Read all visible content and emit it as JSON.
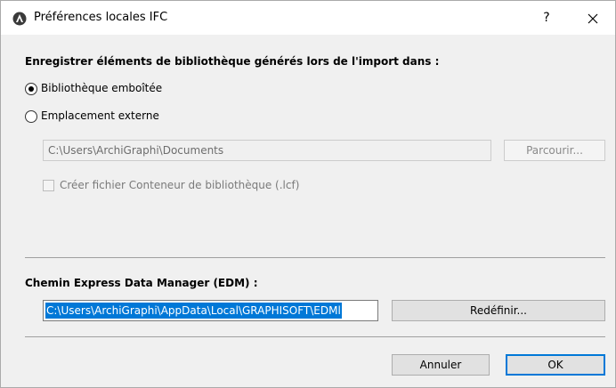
{
  "window": {
    "title": "Préférences locales IFC",
    "help_label": "?",
    "icon": "archicad-app-icon"
  },
  "library_section": {
    "heading": "Enregistrer éléments de bibliothèque générés lors de l'import dans :",
    "options": [
      {
        "label": "Bibliothèque emboîtée",
        "selected": true
      },
      {
        "label": "Emplacement externe",
        "selected": false
      }
    ],
    "external_path": "C:\\Users\\ArchiGraphi\\Documents",
    "browse_label": "Parcourir...",
    "container_checkbox": {
      "label": "Créer fichier Conteneur de bibliothèque (.lcf)",
      "checked": false,
      "enabled": false
    }
  },
  "edm_section": {
    "heading": "Chemin Express Data Manager (EDM) :",
    "path_value": "C:\\Users\\ArchiGraphi\\AppData\\Local\\GRAPHISOFT\\EDMl",
    "redefine_label": "Redéfinir..."
  },
  "footer": {
    "cancel_label": "Annuler",
    "ok_label": "OK"
  },
  "colors": {
    "accent": "#0078d7",
    "dialog_bg": "#f0f0f0",
    "disabled_text": "#6d6d6d"
  }
}
